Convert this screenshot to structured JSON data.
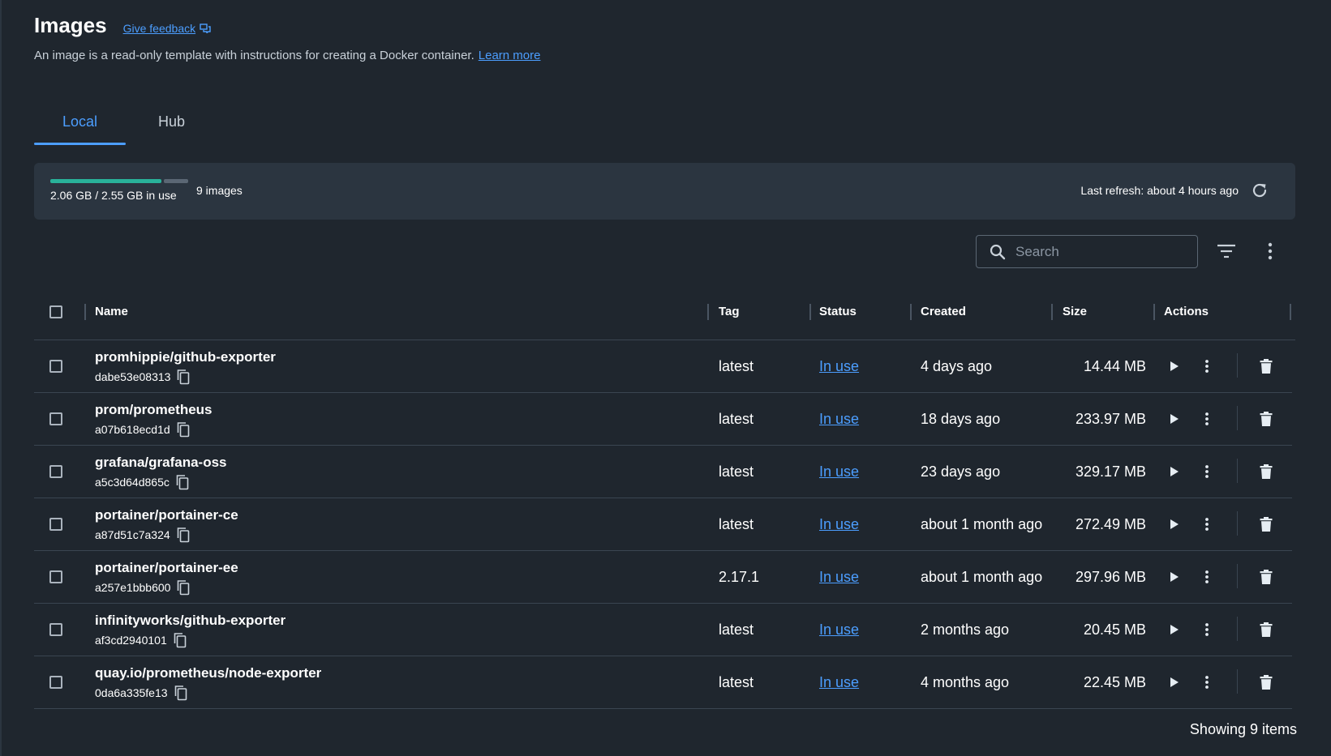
{
  "header": {
    "title": "Images",
    "feedback_label": "Give feedback",
    "description": "An image is a read-only template with instructions for creating a Docker container.",
    "learn_more": "Learn more"
  },
  "tabs": [
    {
      "label": "Local",
      "active": true
    },
    {
      "label": "Hub",
      "active": false
    }
  ],
  "usage": {
    "used_fraction": 0.808,
    "text": "2.06 GB / 2.55 GB in use",
    "count": "9 images",
    "last_refresh": "Last refresh: about 4 hours ago"
  },
  "search": {
    "placeholder": "Search"
  },
  "table": {
    "columns": [
      "Name",
      "Tag",
      "Status",
      "Created",
      "Size",
      "Actions"
    ],
    "rows": [
      {
        "name": "promhippie/github-exporter",
        "id": "dabe53e08313",
        "tag": "latest",
        "status": "In use",
        "created": "4 days ago",
        "size": "14.44 MB"
      },
      {
        "name": "prom/prometheus",
        "id": "a07b618ecd1d",
        "tag": "latest",
        "status": "In use",
        "created": "18 days ago",
        "size": "233.97 MB"
      },
      {
        "name": "grafana/grafana-oss",
        "id": "a5c3d64d865c",
        "tag": "latest",
        "status": "In use",
        "created": "23 days ago",
        "size": "329.17 MB"
      },
      {
        "name": "portainer/portainer-ce",
        "id": "a87d51c7a324",
        "tag": "latest",
        "status": "In use",
        "created": "about 1 month ago",
        "size": "272.49 MB"
      },
      {
        "name": "portainer/portainer-ee",
        "id": "a257e1bbb600",
        "tag": "2.17.1",
        "status": "In use",
        "created": "about 1 month ago",
        "size": "297.96 MB"
      },
      {
        "name": "infinityworks/github-exporter",
        "id": "af3cd2940101",
        "tag": "latest",
        "status": "In use",
        "created": "2 months ago",
        "size": "20.45 MB"
      },
      {
        "name": "quay.io/prometheus/node-exporter",
        "id": "0da6a335fe13",
        "tag": "latest",
        "status": "In use",
        "created": "4 months ago",
        "size": "22.45 MB"
      }
    ]
  },
  "footer": {
    "showing": "Showing 9 items"
  },
  "colors": {
    "accent": "#4c9eff",
    "usage_bar": "#29b29a",
    "background": "#1f262e",
    "panel": "#2b3540"
  }
}
